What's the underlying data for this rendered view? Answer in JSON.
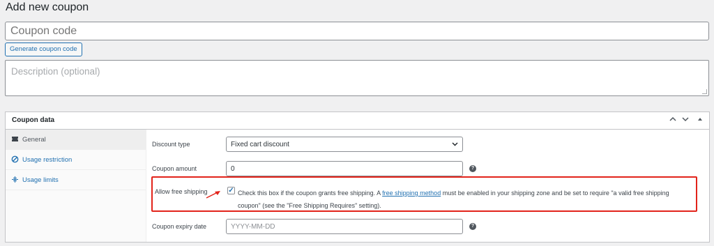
{
  "page": {
    "title": "Add new coupon"
  },
  "coupon_code": {
    "placeholder": "Coupon code"
  },
  "generate_button": {
    "label": "Generate coupon code"
  },
  "description": {
    "placeholder": "Description (optional)"
  },
  "coupon_data": {
    "title": "Coupon data",
    "controls": {
      "up": "⌃",
      "down": "⌄",
      "toggle": "▲"
    },
    "tabs": [
      {
        "label": "General",
        "icon": "ticket-icon",
        "active": true
      },
      {
        "label": "Usage restriction",
        "icon": "prohibited-icon",
        "active": false
      },
      {
        "label": "Usage limits",
        "icon": "plus-cross-icon",
        "active": false
      }
    ],
    "general": {
      "discount_type": {
        "label": "Discount type",
        "value": "Fixed cart discount"
      },
      "coupon_amount": {
        "label": "Coupon amount",
        "value": "0"
      },
      "free_shipping": {
        "label": "Allow free shipping",
        "checked": true,
        "text_before": "Check this box if the coupon grants free shipping. A ",
        "link": "free shipping method",
        "text_after": " must be enabled in your shipping zone and be set to require \"a valid free shipping coupon\" (see the \"Free Shipping Requires\" setting)."
      },
      "expiry": {
        "label": "Coupon expiry date",
        "placeholder": "YYYY-MM-DD"
      }
    }
  },
  "colors": {
    "accent": "#2271b1",
    "highlight": "#e2231a",
    "background": "#f0f0f1"
  }
}
